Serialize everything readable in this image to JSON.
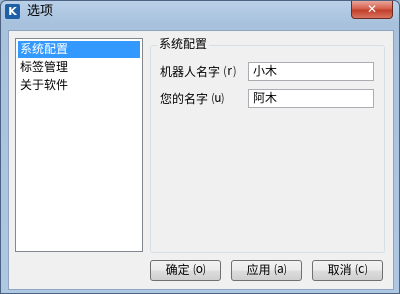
{
  "window": {
    "title": "选项",
    "app_icon_letter": "K",
    "close_glyph": "✕"
  },
  "nav": {
    "items": [
      {
        "label": "系统配置",
        "selected": true
      },
      {
        "label": "标签管理",
        "selected": false
      },
      {
        "label": "关于软件",
        "selected": false
      }
    ]
  },
  "panel": {
    "title": "系统配置",
    "fields": [
      {
        "label": "机器人名字 ⒭",
        "value": "小木"
      },
      {
        "label": "您的名字 ⒰",
        "value": "阿木"
      }
    ]
  },
  "buttons": {
    "ok": "确定 ⒪",
    "apply": "应用 ⒜",
    "cancel": "取消 ⒞"
  },
  "colors": {
    "selection": "#3399ff",
    "titlebar": "#b9d0e8",
    "close": "#c1402b"
  }
}
